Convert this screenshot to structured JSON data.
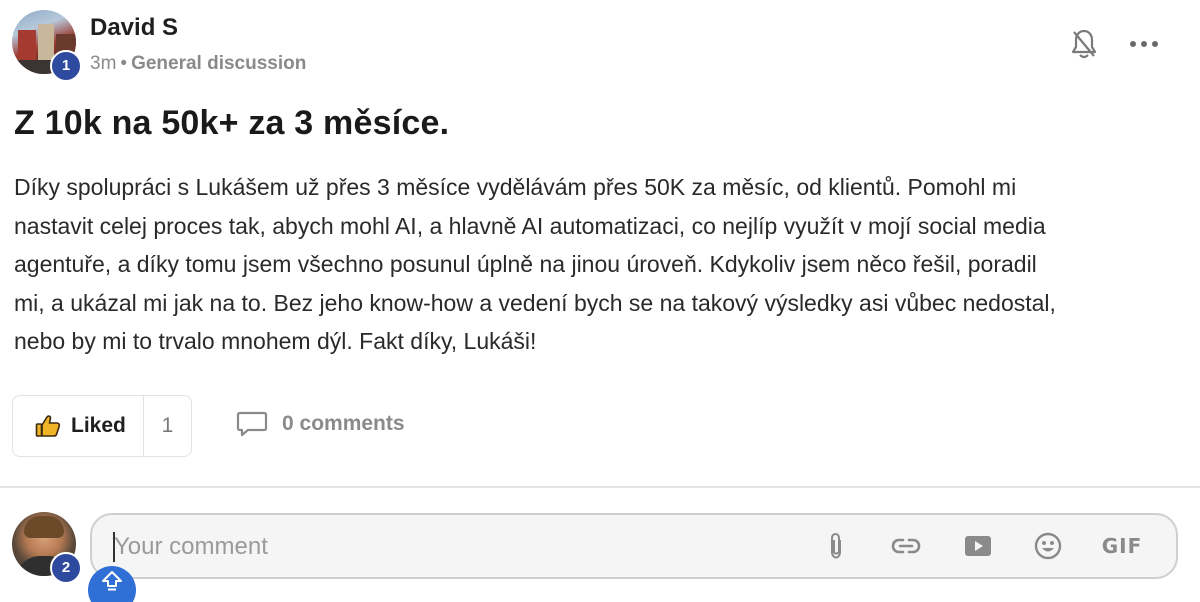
{
  "post": {
    "author": {
      "name": "David S",
      "level": "1"
    },
    "time": "3m",
    "separator": "•",
    "category": "General discussion",
    "title": "Z 10k na 50k+ za 3 měsíce.",
    "body_lines": [
      "Díky spolupráci s Lukášem už přes 3 měsíce vydělávám přes 50K za měsíc, od klientů. Pomohl mi",
      "nastavit celej proces tak, abych mohl AI, a hlavně AI automatizaci, co nejlíp využít v mojí social media",
      "agentuře, a díky tomu jsem všechno posunul úplně na jinou úroveň. Kdykoliv jsem něco řešil, poradil",
      "mi, a ukázal mi jak na to. Bez jeho know-how a vedení bych se na takový výsledky asi vůbec nedostal,",
      "nebo by mi to trvalo mnohem dýl. Fakt díky, Lukáši!"
    ]
  },
  "header_icons": [
    "bell-off-icon",
    "more-options-icon"
  ],
  "actions": {
    "like_label": "Liked",
    "like_count": "1",
    "comments_label": "0 comments"
  },
  "composer": {
    "user_level": "2",
    "placeholder": "Your comment",
    "tools": [
      "attachment-icon",
      "link-icon",
      "video-icon",
      "emoji-icon",
      "gif"
    ],
    "gif_label": "GIF"
  },
  "colors": {
    "level_badge": "#2e4a9e",
    "scroll_up_button": "#2f6fd6",
    "like_icon": "#f0b429"
  }
}
